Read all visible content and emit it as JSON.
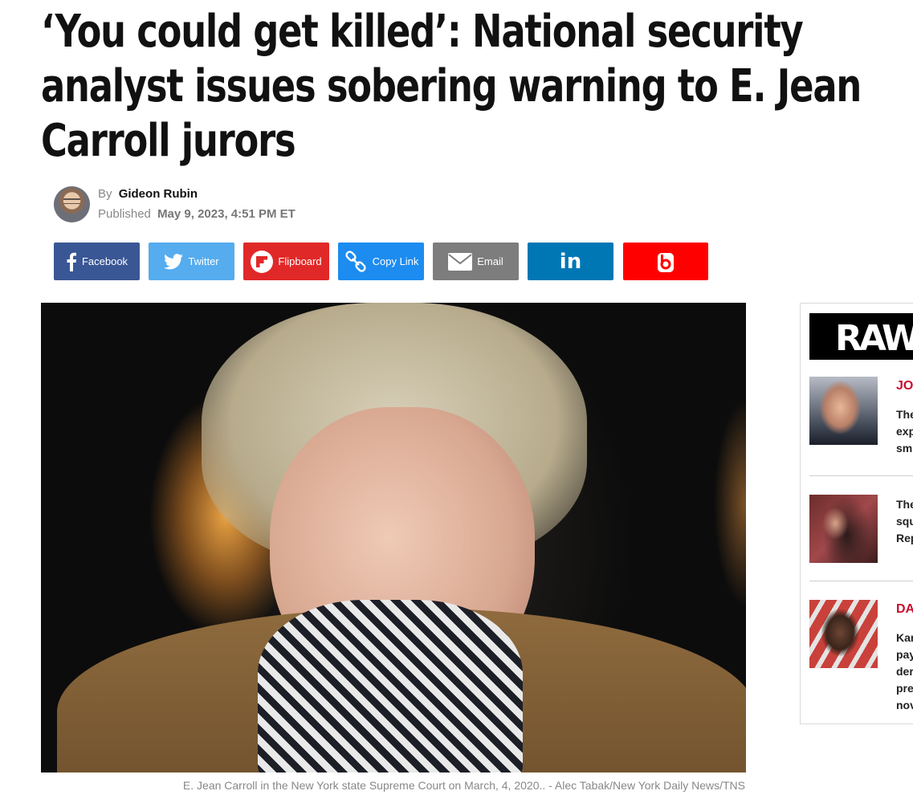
{
  "article": {
    "headline_lines": [
      "‘You could get killed’: National security",
      "analyst issues sobering warning to E. Jean",
      "Carroll jurors"
    ],
    "by_label": "By",
    "author": "Gideon Rubin",
    "published_label": "Published",
    "published_date": "May 9, 2023, 4:51 PM ET",
    "caption": "E. Jean Carroll in the New York state Supreme Court on March, 4, 2020.. - Alec Tabak/New York Daily News/TNS"
  },
  "share": {
    "facebook": "Facebook",
    "twitter": "Twitter",
    "flipboard": "Flipboard",
    "copy_link": "Copy Link",
    "email": "Email",
    "linkedin": "in"
  },
  "colors": {
    "facebook": "#3a5795",
    "twitter": "#55acee",
    "flipboard": "#e12828",
    "copy_link": "#1c8cf0",
    "email": "#7d7d7d",
    "linkedin": "#0077b5",
    "boxbtn": "#ff0000",
    "kicker": "#c8102e"
  },
  "widget": {
    "logo_text": "RAW",
    "items": [
      {
        "kicker": "JOI",
        "lines": [
          "The",
          "exp",
          "sm"
        ]
      },
      {
        "kicker": "",
        "lines": [
          "The",
          "squ",
          "Rep"
        ]
      },
      {
        "kicker": "DA",
        "lines": [
          "Kar",
          "pay",
          "der",
          "pre",
          "nov"
        ]
      }
    ]
  }
}
